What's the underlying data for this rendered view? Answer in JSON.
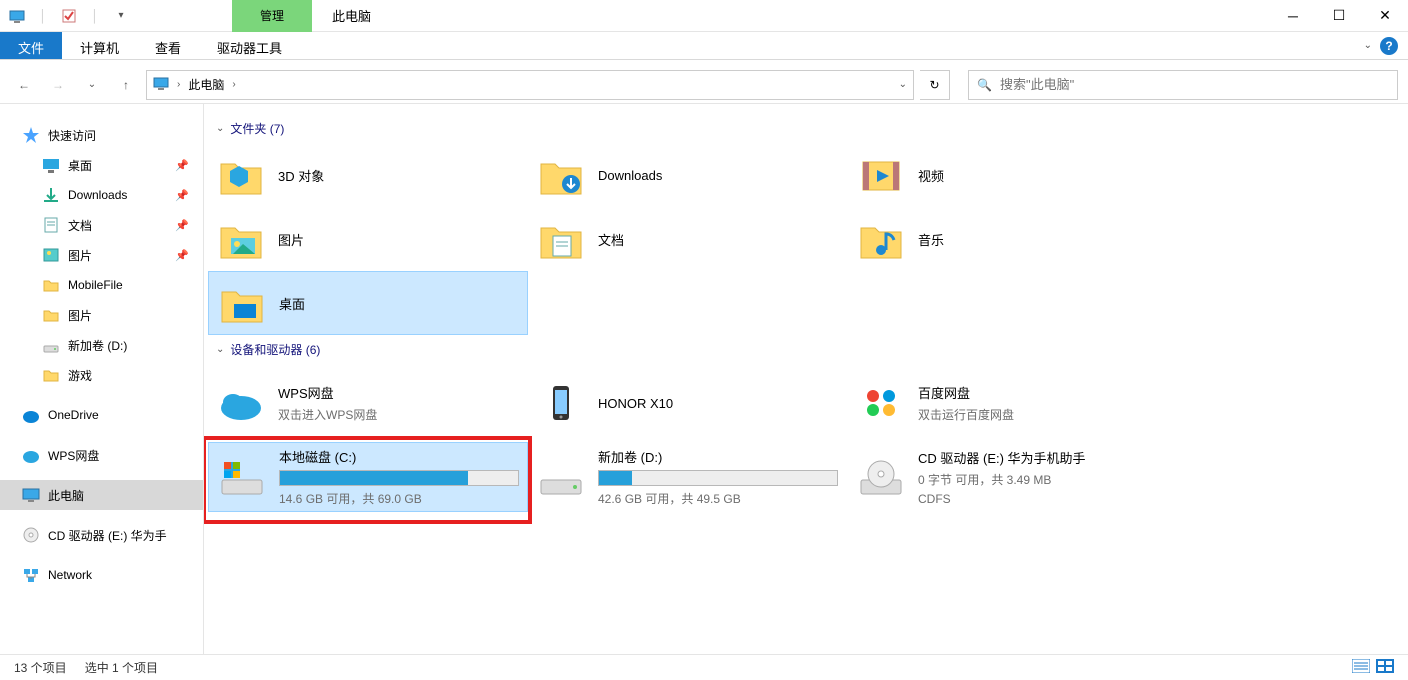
{
  "titlebar": {
    "contextTab": "管理",
    "title": "此电脑"
  },
  "ribbon": {
    "tabs": [
      "文件",
      "计算机",
      "查看",
      "驱动器工具"
    ],
    "activeIndex": 0
  },
  "nav": {
    "breadcrumb": "此电脑",
    "searchPlaceholder": "搜索\"此电脑\""
  },
  "sidebar": {
    "groups": [
      {
        "label": "快速访问",
        "icon": "star",
        "items": [
          {
            "label": "桌面",
            "icon": "desktop",
            "pinned": true
          },
          {
            "label": "Downloads",
            "icon": "downloads",
            "pinned": true
          },
          {
            "label": "文档",
            "icon": "docs",
            "pinned": true
          },
          {
            "label": "图片",
            "icon": "pics",
            "pinned": true
          },
          {
            "label": "MobileFile",
            "icon": "folder",
            "pinned": false
          },
          {
            "label": "图片",
            "icon": "folder",
            "pinned": false
          },
          {
            "label": "新加卷 (D:)",
            "icon": "drive",
            "pinned": false
          },
          {
            "label": "游戏",
            "icon": "folder",
            "pinned": false
          }
        ]
      },
      {
        "label": "OneDrive",
        "icon": "onedrive",
        "items": []
      },
      {
        "label": "WPS网盘",
        "icon": "wps",
        "items": []
      },
      {
        "label": "此电脑",
        "icon": "pc",
        "selected": true,
        "items": []
      },
      {
        "label": "CD 驱动器 (E:) 华为手",
        "icon": "cd",
        "items": []
      },
      {
        "label": "Network",
        "icon": "network",
        "items": []
      }
    ]
  },
  "sections": {
    "folders": {
      "header": "文件夹 (7)",
      "items": [
        {
          "name": "3D 对象",
          "icon": "3d"
        },
        {
          "name": "Downloads",
          "icon": "downloads"
        },
        {
          "name": "视频",
          "icon": "video"
        },
        {
          "name": "图片",
          "icon": "pics"
        },
        {
          "name": "文档",
          "icon": "docs"
        },
        {
          "name": "音乐",
          "icon": "music"
        },
        {
          "name": "桌面",
          "icon": "desktop",
          "selected": true
        }
      ]
    },
    "drives": {
      "header": "设备和驱动器 (6)",
      "items": [
        {
          "name": "WPS网盘",
          "sub": "双击进入WPS网盘",
          "icon": "wps-cloud",
          "type": "app"
        },
        {
          "name": "HONOR X10",
          "sub": "",
          "icon": "phone",
          "type": "device"
        },
        {
          "name": "百度网盘",
          "sub": "双击运行百度网盘",
          "icon": "baidu",
          "type": "app"
        },
        {
          "name": "本地磁盘 (C:)",
          "sub": "14.6 GB 可用，共 69.0 GB",
          "icon": "win-drive",
          "type": "drive",
          "fillPct": 79,
          "selected": true,
          "highlight": true
        },
        {
          "name": "新加卷 (D:)",
          "sub": "42.6 GB 可用，共 49.5 GB",
          "icon": "drive",
          "type": "drive",
          "fillPct": 14
        },
        {
          "name": "CD 驱动器 (E:) 华为手机助手",
          "sub": "0 字节 可用，共 3.49 MB",
          "sub2": "CDFS",
          "icon": "cd",
          "type": "cd"
        }
      ]
    }
  },
  "status": {
    "left": "13 个项目",
    "mid": "选中 1 个项目"
  }
}
